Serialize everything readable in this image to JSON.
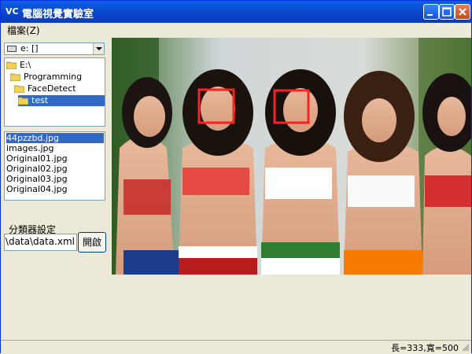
{
  "window": {
    "title": "電腦視覺實驗室",
    "app_icon": "VC"
  },
  "menu": {
    "file_label": "檔案(Z)"
  },
  "drive": {
    "label": "e: []"
  },
  "directories": [
    {
      "label": "E:\\",
      "indent": 0,
      "selected": false
    },
    {
      "label": "Programming",
      "indent": 1,
      "selected": false
    },
    {
      "label": "FaceDetect",
      "indent": 2,
      "selected": false
    },
    {
      "label": "test",
      "indent": 3,
      "selected": true
    }
  ],
  "files": [
    {
      "label": "44pzzbd.jpg",
      "selected": true
    },
    {
      "label": "images.jpg",
      "selected": false
    },
    {
      "label": "Original01.jpg",
      "selected": false
    },
    {
      "label": "Original02.jpg",
      "selected": false
    },
    {
      "label": "Original03.jpg",
      "selected": false
    },
    {
      "label": "Original04.jpg",
      "selected": false
    }
  ],
  "classifier": {
    "label": "分類器設定",
    "path": "ng\\data\\data.xml",
    "open_button": "開啟"
  },
  "status": {
    "text": "長=333,寬=500"
  },
  "colors": {
    "detection_box": "#ff2020",
    "selection": "#316ac5"
  },
  "icons": [
    "minimize-icon",
    "maximize-icon",
    "close-icon",
    "folder-icon",
    "drive-icon",
    "chevron-down-icon"
  ]
}
